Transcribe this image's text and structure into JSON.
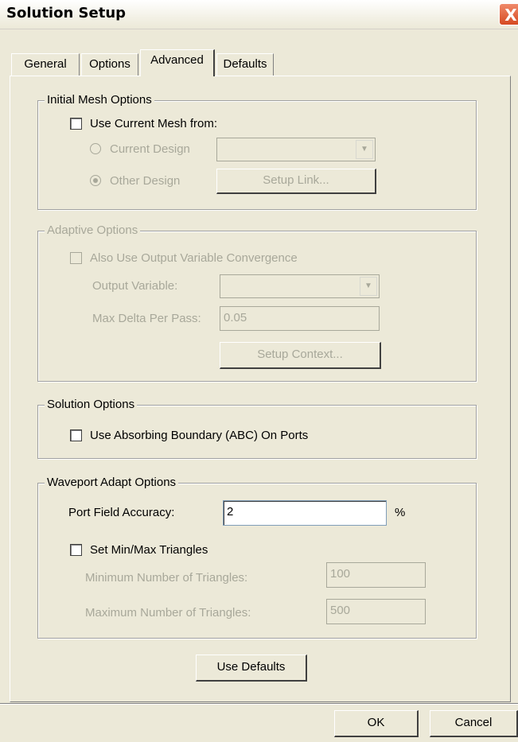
{
  "window": {
    "title": "Solution Setup",
    "close_glyph": "X"
  },
  "tabs": [
    {
      "label": "General"
    },
    {
      "label": "Options"
    },
    {
      "label": "Advanced",
      "active": true
    },
    {
      "label": "Defaults"
    }
  ],
  "initial_mesh": {
    "legend": "Initial Mesh Options",
    "use_current_mesh_label": "Use Current Mesh from:",
    "use_current_mesh_checked": false,
    "current_design_label": "Current Design",
    "current_design_selected": false,
    "current_design_value": "",
    "other_design_label": "Other Design",
    "other_design_selected": true,
    "setup_link_label": "Setup Link..."
  },
  "adaptive": {
    "legend": "Adaptive Options",
    "also_use_label": "Also Use Output Variable Convergence",
    "also_use_checked": false,
    "output_variable_label": "Output Variable:",
    "output_variable_value": "",
    "max_delta_label": "Max Delta Per Pass:",
    "max_delta_value": "0.05",
    "setup_context_label": "Setup Context..."
  },
  "solution": {
    "legend": "Solution Options",
    "abc_label": "Use Absorbing Boundary (ABC) On Ports",
    "abc_checked": false
  },
  "waveport": {
    "legend": "Waveport Adapt Options",
    "port_field_label": "Port Field Accuracy:",
    "port_field_value": "2",
    "port_field_unit": "%",
    "set_minmax_label": "Set Min/Max Triangles",
    "set_minmax_checked": false,
    "min_label": "Minimum Number of Triangles:",
    "min_value": "100",
    "max_label": "Maximum Number of Triangles:",
    "max_value": "500"
  },
  "buttons": {
    "use_defaults": "Use Defaults",
    "ok": "OK",
    "cancel": "Cancel"
  }
}
